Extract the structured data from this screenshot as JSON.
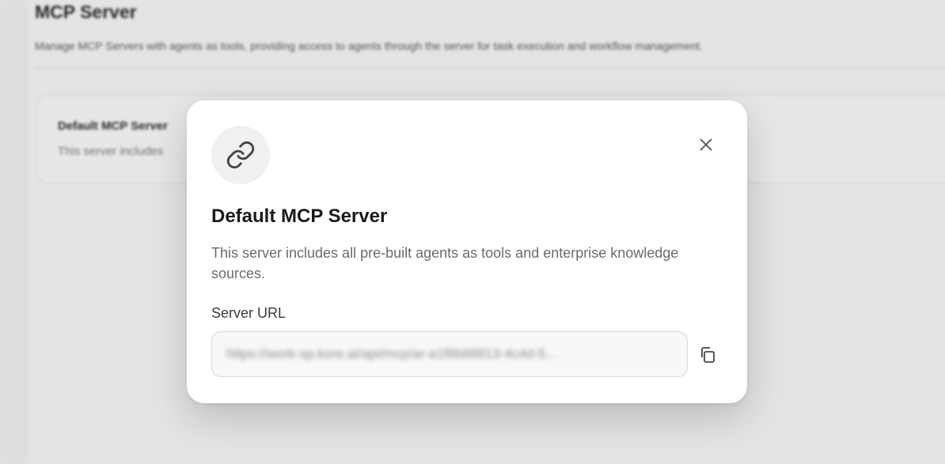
{
  "background": {
    "page_title": "MCP Server",
    "page_subtitle": "Manage MCP Servers with agents as tools, providing access to agents through the server for task execution and workflow management.",
    "card": {
      "title": "Default MCP Server",
      "description": "This server includes"
    }
  },
  "modal": {
    "icon": "link-icon",
    "close_icon": "close-icon",
    "title": "Default MCP Server",
    "description": "This server includes all pre-built agents as tools and enterprise knowledge sources.",
    "server_url_label": "Server URL",
    "server_url_value": "https://work-sp.kore.ai/api/mcp/ar-a1f8b88813-4c4d-5...",
    "copy_icon": "copy-icon"
  }
}
